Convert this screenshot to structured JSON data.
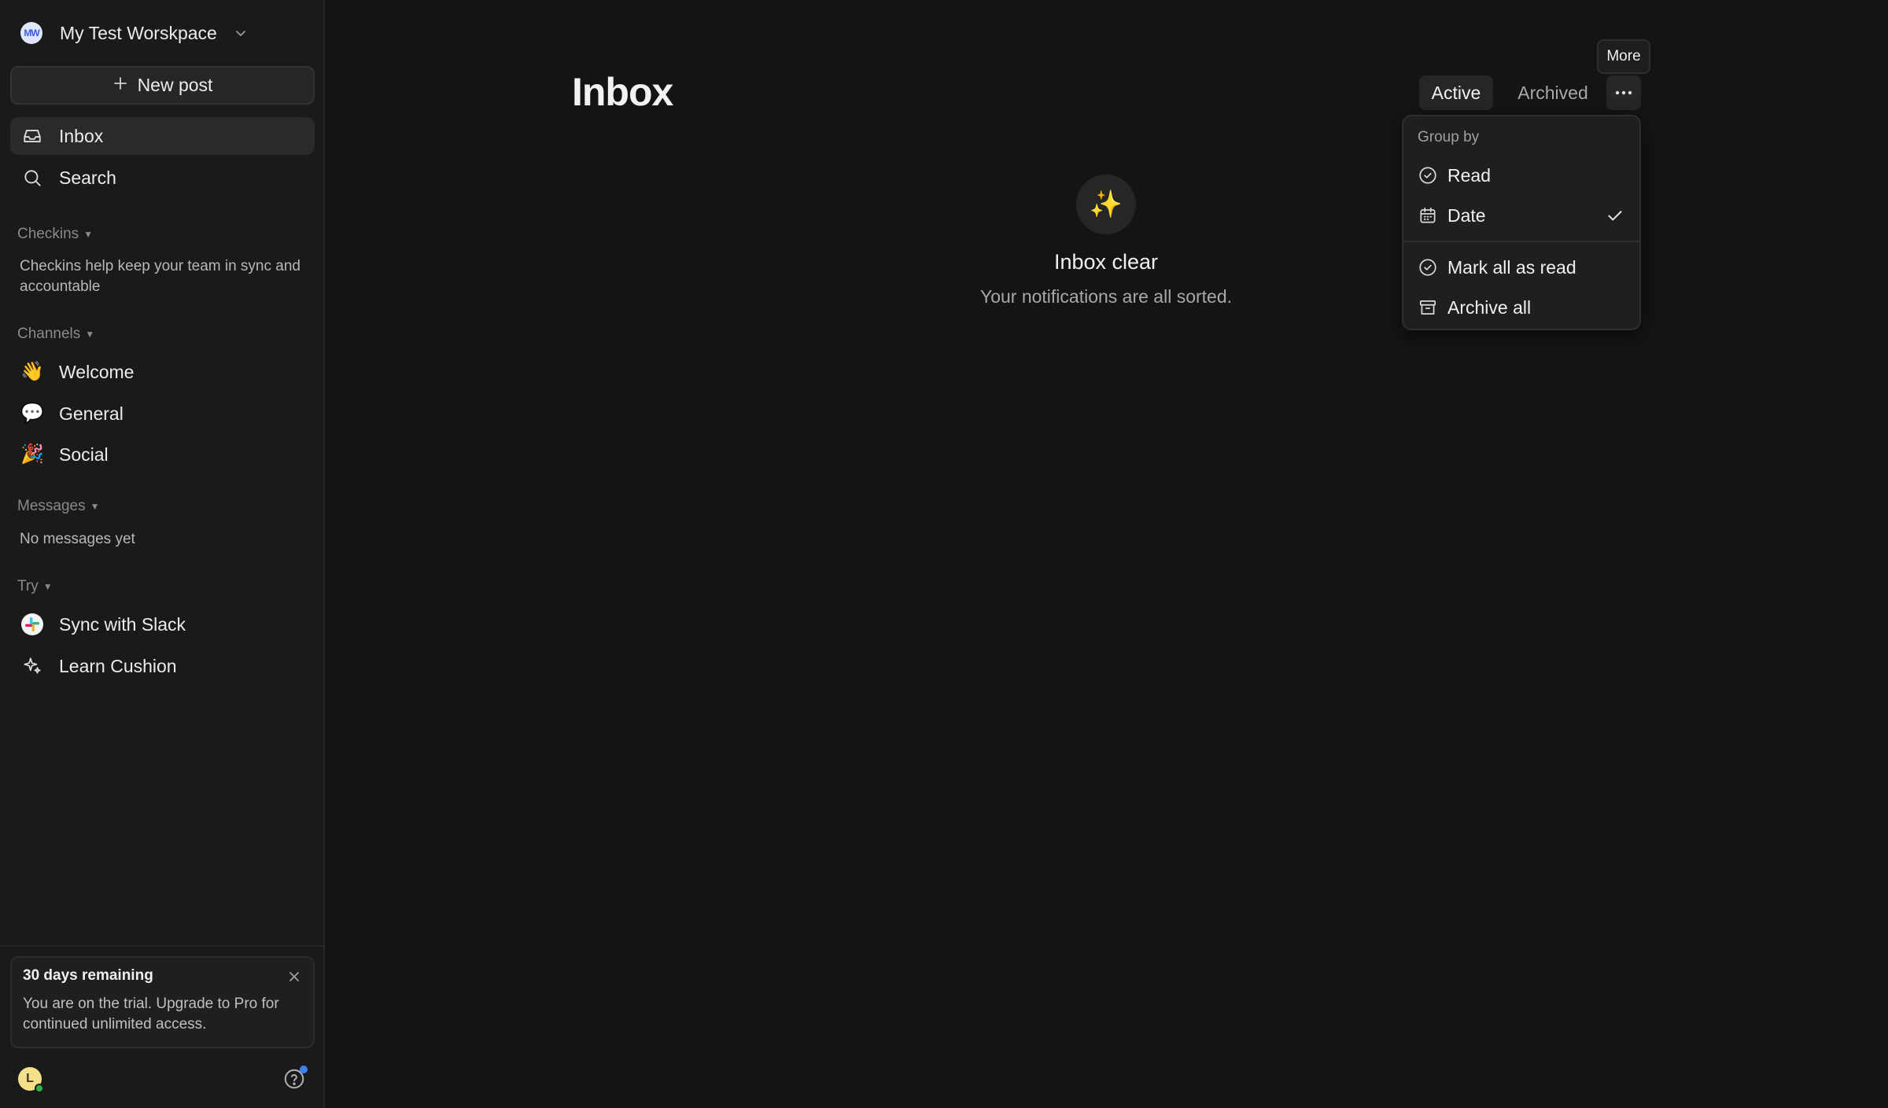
{
  "workspace": {
    "initials": "MW",
    "name": "My Test Worskpace"
  },
  "sidebar": {
    "new_post": "New post",
    "nav": [
      {
        "label": "Inbox",
        "icon": "inbox-icon"
      },
      {
        "label": "Search",
        "icon": "search-icon"
      }
    ],
    "checkins": {
      "heading": "Checkins",
      "note": "Checkins help keep your team in sync and accountable"
    },
    "channels": {
      "heading": "Channels",
      "items": [
        {
          "emoji": "👋",
          "label": "Welcome"
        },
        {
          "emoji": "💬",
          "label": "General"
        },
        {
          "emoji": "🎉",
          "label": "Social"
        }
      ]
    },
    "messages": {
      "heading": "Messages",
      "note": "No messages yet"
    },
    "try": {
      "heading": "Try",
      "items": [
        {
          "label": "Sync with Slack",
          "icon": "slack-icon"
        },
        {
          "label": "Learn Cushion",
          "icon": "sparkle-icon"
        }
      ]
    },
    "trial": {
      "title": "30 days remaining",
      "text": "You are on the trial. Upgrade to Pro for continued unlimited access."
    },
    "user": {
      "initial": "L"
    }
  },
  "main": {
    "title": "Inbox",
    "tabs": {
      "active": "Active",
      "archived": "Archived"
    },
    "more_tooltip": "More",
    "menu": {
      "group_heading": "Group by",
      "read": "Read",
      "date": "Date",
      "mark_all_read": "Mark all as read",
      "archive_all": "Archive all"
    },
    "empty": {
      "emoji": "✨",
      "title": "Inbox clear",
      "subtitle": "Your notifications are all sorted."
    }
  },
  "colors": {
    "background": "#141414",
    "sidebar": "#1a1a1a",
    "surface": "#262626",
    "online": "#2fb344",
    "notify": "#3b82f6"
  }
}
